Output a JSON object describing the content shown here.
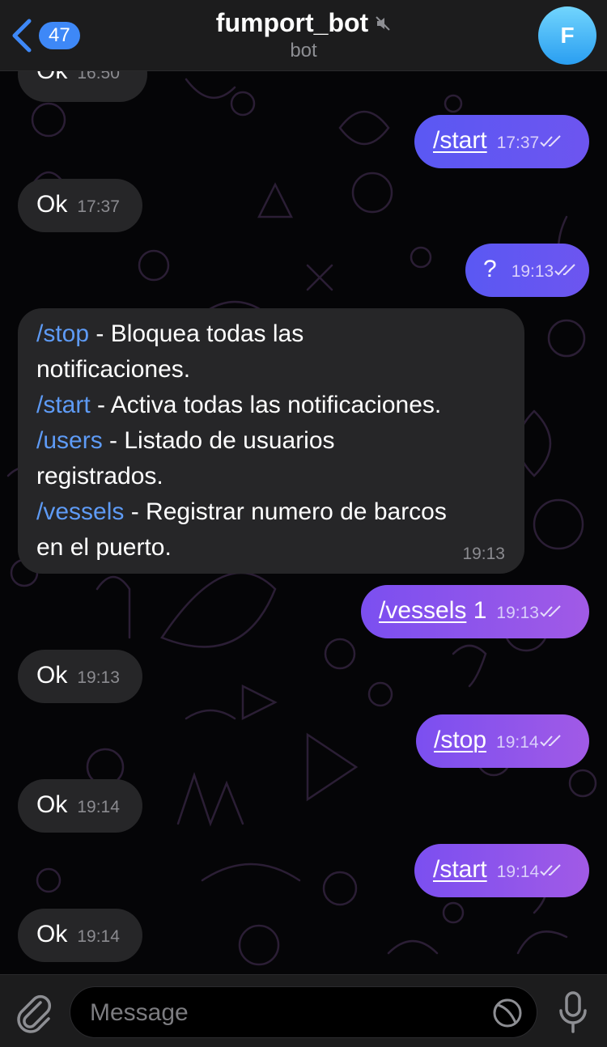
{
  "header": {
    "back_icon": "chevron-left-icon",
    "unread_count": "47",
    "title": "fumport_bot",
    "subtitle": "bot",
    "mute_icon": "muted-speaker-icon",
    "avatar_letter": "F"
  },
  "messages": [
    {
      "dir": "in",
      "text": "Ok",
      "time": "16:50"
    },
    {
      "dir": "out",
      "text": "/start",
      "time": "17:37"
    },
    {
      "dir": "in",
      "text": "Ok",
      "time": "17:37"
    },
    {
      "dir": "out",
      "text": "?",
      "time": "19:13"
    },
    {
      "dir": "in",
      "commands": [
        {
          "cmd": "/stop",
          "desc": " - Bloquea todas las"
        },
        {
          "cont": "notificaciones."
        },
        {
          "cmd": "/start",
          "desc": " - Activa todas las notificaciones."
        },
        {
          "cmd": "/users",
          "desc": " - Listado de usuarios"
        },
        {
          "cont": "registrados."
        },
        {
          "cmd": "/vessels",
          "desc": " - Registrar numero de barcos"
        },
        {
          "cont": "en el puerto."
        }
      ],
      "time": "19:13"
    },
    {
      "dir": "out",
      "text": "/vessels",
      "suffix": " 1",
      "time": "19:13"
    },
    {
      "dir": "in",
      "text": "Ok",
      "time": "19:13"
    },
    {
      "dir": "out",
      "text": "/stop",
      "time": "19:14"
    },
    {
      "dir": "in",
      "text": "Ok",
      "time": "19:14"
    },
    {
      "dir": "out",
      "text": "/start",
      "time": "19:14"
    },
    {
      "dir": "in",
      "text": "Ok",
      "time": "19:14"
    }
  ],
  "composer": {
    "attach_icon": "paperclip-icon",
    "placeholder": "Message",
    "sticker_icon": "sticker-icon",
    "mic_icon": "microphone-icon"
  },
  "colors": {
    "incoming_bubble": "#262628",
    "outgoing_purple": "#8a55ee",
    "outgoing_blue": "#5a58f3",
    "link_blue": "#5e9bf6",
    "badge_blue": "#3e88f7"
  }
}
